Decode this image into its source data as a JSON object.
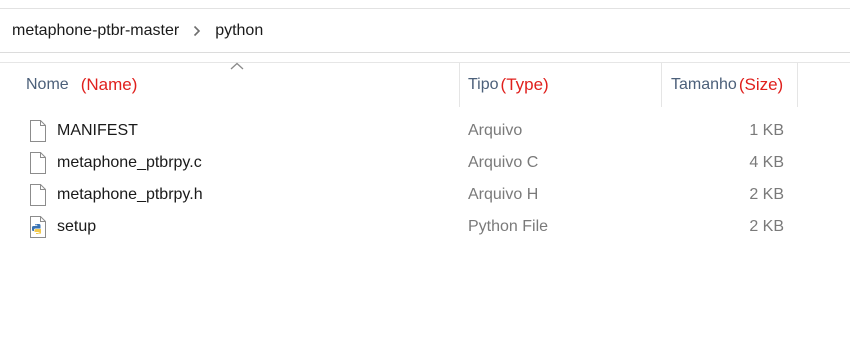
{
  "breadcrumb": {
    "items": [
      "metaphone-ptbr-master",
      "python"
    ]
  },
  "columns": {
    "name": {
      "label": "Nome",
      "annotation": "(Name)"
    },
    "type": {
      "label": "Tipo",
      "annotation": "(Type)"
    },
    "size": {
      "label": "Tamanho",
      "annotation": "(Size)"
    }
  },
  "annotation_color": "#e0201d",
  "files": [
    {
      "name": "MANIFEST",
      "type": "Arquivo",
      "size": "1 KB",
      "icon": "file-icon"
    },
    {
      "name": "metaphone_ptbrpy.c",
      "type": "Arquivo C",
      "size": "4 KB",
      "icon": "file-icon"
    },
    {
      "name": "metaphone_ptbrpy.h",
      "type": "Arquivo H",
      "size": "2 KB",
      "icon": "file-icon"
    },
    {
      "name": "setup",
      "type": "Python File",
      "size": "2 KB",
      "icon": "python-file-icon"
    }
  ]
}
